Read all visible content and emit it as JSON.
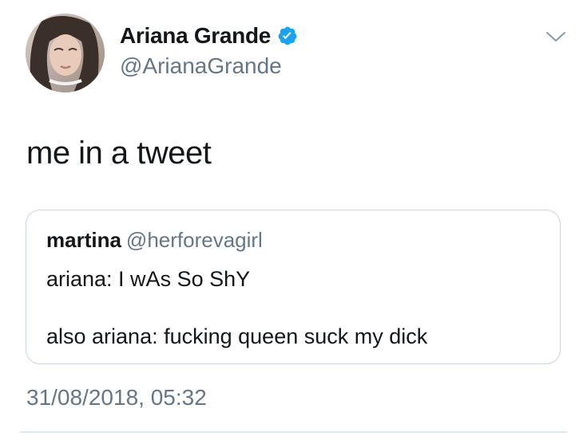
{
  "author": {
    "display_name": "Ariana Grande",
    "handle": "@ArianaGrande",
    "verified": true,
    "avatar_icon": "profile-photo"
  },
  "tweet": {
    "text": "me in a tweet",
    "timestamp": "31/08/2018, 05:32"
  },
  "quoted_tweet": {
    "display_name": "martina",
    "handle": "@herforevagirl",
    "line1": "ariana: I wAs So ShY",
    "line2": "also ariana: fucking queen suck my dick"
  },
  "colors": {
    "text_primary": "#14171a",
    "text_secondary": "#657786",
    "verified_blue": "#1da1f2",
    "border": "#ccd6dd"
  },
  "icons": {
    "verified": "verified-badge-icon",
    "more": "chevron-down-icon"
  }
}
